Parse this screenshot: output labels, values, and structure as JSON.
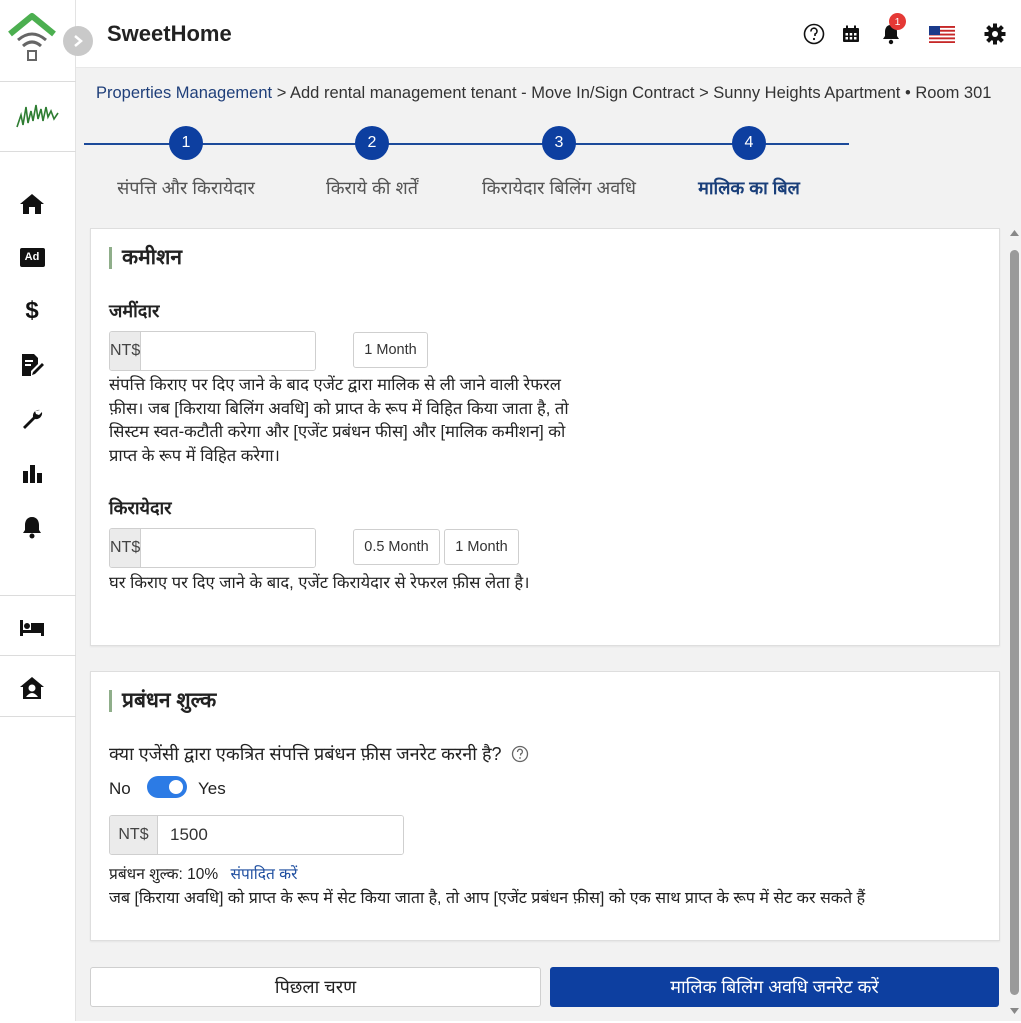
{
  "app": {
    "title": "SweetHome"
  },
  "topbar": {
    "notification_count": "1",
    "icons": [
      "help-icon",
      "calendar-icon",
      "bell-icon",
      "us-flag-icon",
      "gear-icon"
    ]
  },
  "sidebar": {
    "items": [
      {
        "name": "home-icon"
      },
      {
        "name": "ad-icon",
        "label": "Ad"
      },
      {
        "name": "dollar-icon",
        "label": "$"
      },
      {
        "name": "contract-edit-icon"
      },
      {
        "name": "wrench-icon"
      },
      {
        "name": "bar-chart-icon"
      },
      {
        "name": "bell-icon"
      },
      {
        "name": "bed-icon"
      },
      {
        "name": "house-user-icon"
      }
    ]
  },
  "breadcrumb": {
    "link": "Properties Management",
    "rest": " > Add rental management tenant - Move In/Sign Contract > Sunny Heights Apartment • Room 301"
  },
  "steps": [
    {
      "number": "1",
      "label": "संपत्ति और किरायेदार"
    },
    {
      "number": "2",
      "label": "किराये की शर्तें"
    },
    {
      "number": "3",
      "label": "किरायेदार बिलिंग अवधि"
    },
    {
      "number": "4",
      "label": "मालिक का बिल"
    }
  ],
  "commission": {
    "title": "कमीशन",
    "landlord": {
      "label": "जमींदार",
      "prefix": "NT$",
      "value": "",
      "options": [
        "1 Month"
      ],
      "description": "संपत्ति किराए पर दिए जाने के बाद एजेंट द्वारा मालिक से ली जाने वाली रेफरल फ़ीस। जब [किराया बिलिंग अवधि] को प्राप्त के रूप में विहित किया जाता है, तो सिस्टम स्वत-कटौती करेगा और [एजेंट प्रबंधन फीस] और [मालिक कमीशन] को प्राप्त के रूप में विहित करेगा।"
    },
    "tenant": {
      "label": "किरायेदार",
      "prefix": "NT$",
      "value": "",
      "options": [
        "0.5 Month",
        "1 Month"
      ],
      "description": "घर किराए पर दिए जाने के बाद, एजेंट किरायेदार से रेफरल फ़ीस लेता है।"
    }
  },
  "management": {
    "title": "प्रबंधन शुल्क",
    "question": "क्या एजेंसी द्वारा एकत्रित संपत्ति प्रबंधन फ़ीस जनरेट करनी है?",
    "toggle_off_label": "No",
    "toggle_on_label": "Yes",
    "toggle_on": true,
    "prefix": "NT$",
    "value": "1500",
    "fee_rate": "प्रबंधन शुल्क: 10%",
    "edit_link": "संपादित करें",
    "note": "जब [किराया अवधि] को प्राप्त के रूप में सेट किया जाता है, तो आप [एजेंट प्रबंधन फ़ीस] को एक साथ प्राप्त के रूप में सेट कर सकते हैं"
  },
  "actions": {
    "previous": "पिछला चरण",
    "generate": "मालिक बिलिंग अवधि जनरेट करें"
  },
  "colors": {
    "primary": "#0d3fa0",
    "accent_bar": "#8fae8a",
    "toggle": "#2c7be5",
    "badge": "#e53935"
  }
}
